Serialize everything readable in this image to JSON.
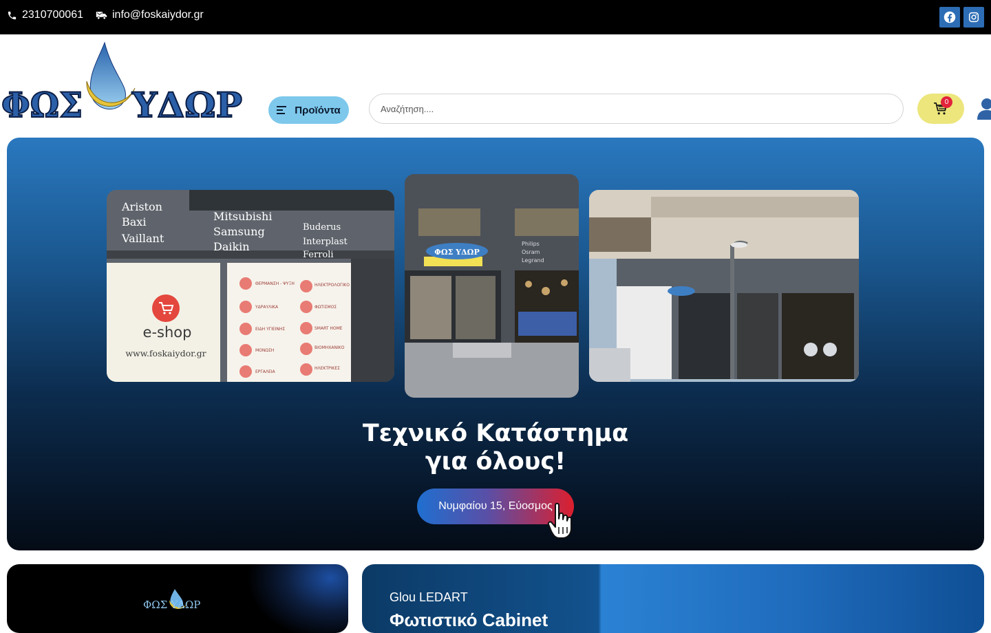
{
  "topbar": {
    "phone": "2310700061",
    "email": "info@foskaiydor.gr",
    "social": [
      "facebook-icon",
      "instagram-icon"
    ]
  },
  "header": {
    "logo_text": "ΦΩΣ ΥΔΩΡ",
    "products_label": "Προϊόντα",
    "search_placeholder": "Αναζήτηση....",
    "cart_count": "0"
  },
  "hero": {
    "photo_left": {
      "brands_col1": [
        "Ariston",
        "Baxi",
        "Vaillant"
      ],
      "brands_col2": [
        "Mitsubishi",
        "Samsung",
        "Daikin"
      ],
      "brands_col3": [
        "Buderus",
        "Interplast",
        "Ferroli"
      ],
      "eshop": "e-shop",
      "url": "www.foskaiydor.gr"
    },
    "photo_center": {
      "brands": [
        "Philips",
        "Osram",
        "Legrand"
      ]
    },
    "title_line1": "Τεχνικό Κατάστημα",
    "title_line2": "για όλους!",
    "address_button": "Νυμφαίου 15, Εύοσμος"
  },
  "cards": {
    "left_logo": "ΦΩΣ ΥΔΩΡ",
    "right_brand": "Glou LEDART",
    "right_title": "Φωτιστικό Cabinet"
  },
  "colors": {
    "accent_blue": "#7ec8ec",
    "cart_yellow": "#ece67c",
    "social_blue": "#2d6db5",
    "badge_red": "#e2233a"
  }
}
